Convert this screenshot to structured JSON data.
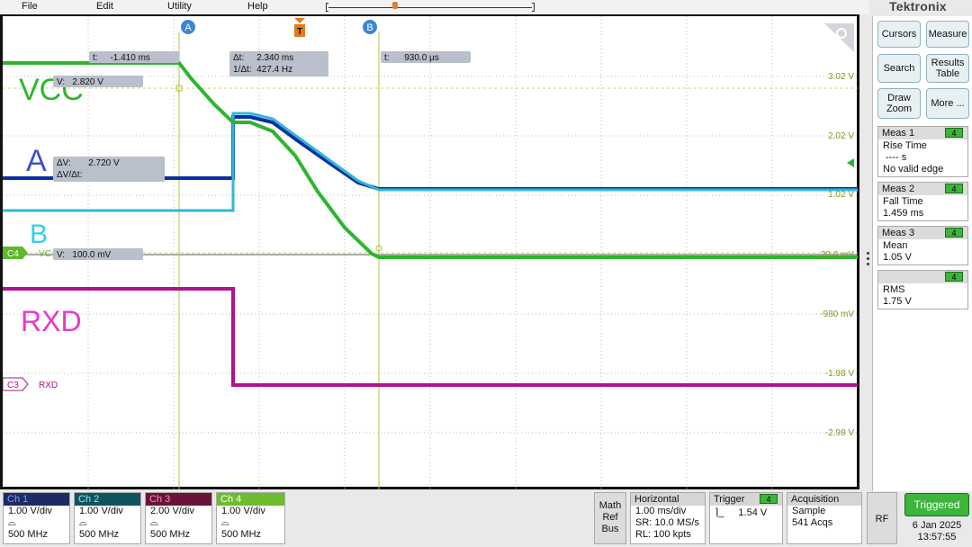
{
  "menu": {
    "items": [
      "File",
      "Edit",
      "Utility",
      "Help"
    ]
  },
  "brand": "Tektronix",
  "right_buttons": {
    "cursors": "Cursors",
    "measure": "Measure",
    "search": "Search",
    "results_table": "Results Table",
    "draw_zoom": "Draw Zoom",
    "more": "More ..."
  },
  "measurements": [
    {
      "title": "Meas 1",
      "badge": "4",
      "lines": [
        "Rise Time",
        "---- s",
        "No valid edge"
      ]
    },
    {
      "title": "Meas 2",
      "badge": "4",
      "lines": [
        "Fall Time",
        "1.459 ms"
      ]
    },
    {
      "title": "Meas 3",
      "badge": "4",
      "lines": [
        "Mean",
        "1.05 V"
      ]
    },
    {
      "title": "",
      "badge": "4",
      "lines": [
        "RMS",
        "1.75 V"
      ]
    }
  ],
  "screen": {
    "cursor_a_label": "A",
    "cursor_b_label": "B",
    "trigger_marker": "T",
    "readouts": {
      "t_a": "t:     -1.410 ms",
      "v_a": "V:   2.820 V",
      "dt": "Δt:     2.340 ms",
      "inv_dt": "1/Δt:  427.4 Hz",
      "t_b": "t:      930.0 µs",
      "dv": "ΔV:       2.720 V",
      "dv_dt": "ΔV/Δt:",
      "v_b": "V:   100.0 mV"
    },
    "labels": {
      "vcc": "VCC",
      "a": "A",
      "b": "B",
      "rxd": "RXD",
      "c4_marker": "C4",
      "c4_name": "VC",
      "c3_marker": "C3",
      "c3_name": "RXD"
    },
    "scale_labels": [
      "3.02 V",
      "2.02 V",
      "1.02 V",
      "20.0 mV",
      "-980 mV",
      "-1.98 V",
      "-2.98 V"
    ],
    "colors": {
      "ch1": "#0b2ea0",
      "ch2": "#2fb8d8",
      "ch3": "#b0148c",
      "ch4": "#2db52d",
      "cursor": "#a8c83a"
    }
  },
  "channels": [
    {
      "name": "Ch 1",
      "scale": "1.00 V/div",
      "bw": "500 MHz",
      "header_bg": "#1d2a63",
      "header_fg": "#6fa0ff"
    },
    {
      "name": "Ch 2",
      "scale": "1.00 V/div",
      "bw": "500 MHz",
      "header_bg": "#10545f",
      "header_fg": "#8fe6ff"
    },
    {
      "name": "Ch 3",
      "scale": "2.00 V/div",
      "bw": "500 MHz",
      "header_bg": "#6a1338",
      "header_fg": "#ff8ac8"
    },
    {
      "name": "Ch 4",
      "scale": "1.00 V/div",
      "bw": "500 MHz",
      "header_bg": "#6cbc2d",
      "header_fg": "#ffffff"
    }
  ],
  "math_ref_bus": [
    "Math",
    "Ref",
    "Bus"
  ],
  "horizontal": {
    "title": "Horizontal",
    "lines": [
      "1.00 ms/div",
      "SR: 10.0 MS/s",
      "RL: 100 kpts"
    ]
  },
  "trigger": {
    "title": "Trigger",
    "badge": "4",
    "level": "1.54 V"
  },
  "acquisition": {
    "title": "Acquisition",
    "lines": [
      "Sample",
      "541 Acqs"
    ]
  },
  "rf": "RF",
  "status": {
    "triggered": "Triggered",
    "date": "6 Jan 2025",
    "time": "13:57:55"
  }
}
